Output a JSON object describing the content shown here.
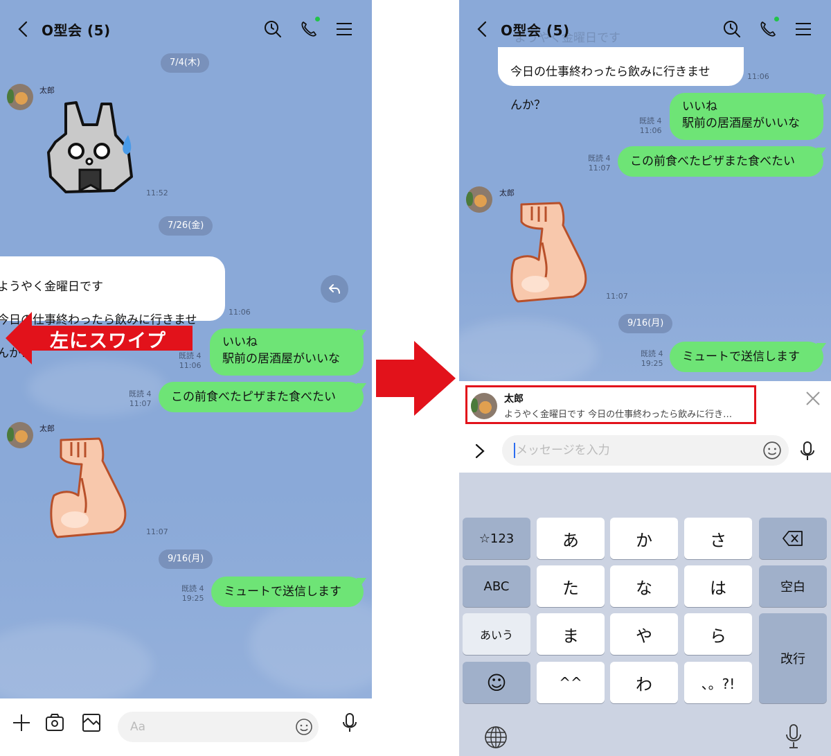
{
  "colors": {
    "chat_background": "#8aa9d8",
    "sent_bubble": "#6ee476",
    "received_bubble": "#ffffff",
    "annotation_red": "#e2121b",
    "online_dot": "#22c34a"
  },
  "left_screen": {
    "header": {
      "title": "O型会 (5)",
      "back_icon": "chevron-left-icon",
      "icons": [
        "search-clock-icon",
        "phone-icon",
        "menu-icon"
      ]
    },
    "dates": [
      "7/4(木)",
      "7/26(金)",
      "9/16(月)"
    ],
    "messages": [
      {
        "type": "sticker",
        "sender": "太郎",
        "sticker": "shocked-rabbit",
        "time": "11:52"
      },
      {
        "type": "text",
        "sender": "太郎",
        "text": "ようやく金曜日です\n今日の仕事終わったら飲みに行きませんか？",
        "time": "11:06"
      },
      {
        "type": "text",
        "from_me": true,
        "text": "いいね\n駅前の居酒屋がいいな",
        "read": "既読 4",
        "time": "11:06"
      },
      {
        "type": "text",
        "from_me": true,
        "text": "この前食べたピザまた食べたい",
        "read": "既読 4",
        "time": "11:07"
      },
      {
        "type": "sticker",
        "sender": "太郎",
        "sticker": "flexed-biceps",
        "time": "11:07"
      },
      {
        "type": "text",
        "from_me": true,
        "text": "ミュートで送信します",
        "read": "既読 4",
        "time": "19:25"
      }
    ],
    "partial_bubble_lines": [
      "ようやく金曜日です",
      "今日の仕事終わったら飲みに行きませ",
      "んか？"
    ],
    "annotation": "左にスワイプ",
    "reply_icon": "reply-arrow-icon",
    "bottom_bar": {
      "icons": [
        "plus-icon",
        "camera-icon",
        "image-icon",
        "emoji-icon",
        "mic-icon"
      ],
      "input_placeholder": "Aa"
    }
  },
  "right_screen": {
    "header": {
      "title": "O型会 (5)",
      "faded_behind_text": "ようやく金曜日です"
    },
    "top_bubble_lines": [
      "今日の仕事終わったら飲みに行きませ",
      "んか？"
    ],
    "top_bubble_time": "11:06",
    "reply_preview": {
      "name": "太郎",
      "text": "ようやく金曜日です 今日の仕事終わったら飲みに行き…"
    },
    "message_input_placeholder": "メッセージを入力",
    "keyboard": {
      "rows": [
        [
          "☆123",
          "あ",
          "か",
          "さ",
          "⌫"
        ],
        [
          "ABC",
          "た",
          "な",
          "は",
          "空白"
        ],
        [
          "あいう",
          "ま",
          "や",
          "ら",
          "改行"
        ],
        [
          "☺",
          "^^",
          "わ",
          "、。?!"
        ]
      ],
      "bottom_icons": [
        "globe-icon",
        "dictation-mic-icon"
      ]
    }
  }
}
